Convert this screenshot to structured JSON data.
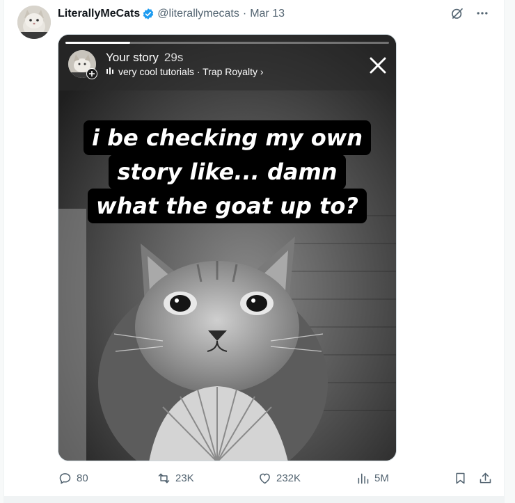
{
  "tweet": {
    "display_name": "LiterallyMeCats",
    "handle": "@literallymecats",
    "separator": "·",
    "date": "Mar 13"
  },
  "story": {
    "title": "Your story",
    "time": "29s",
    "music": "very cool tutorials · Trap Royalty ›",
    "progress": 0.2,
    "caption_lines": [
      "i be checking my own",
      "story like... damn",
      "what the goat up to?"
    ]
  },
  "actions": {
    "replies": "80",
    "reposts": "23K",
    "likes": "232K",
    "views": "5M"
  },
  "colors": {
    "verified": "#1d9bf0",
    "muted_text": "#536471",
    "caption_bg": "#000000"
  },
  "icons": [
    "verified-badge-icon",
    "grok-icon",
    "more-icon",
    "close-icon",
    "music-bars-icon",
    "reply-icon",
    "repost-icon",
    "like-icon",
    "views-icon",
    "bookmark-icon",
    "share-icon"
  ]
}
